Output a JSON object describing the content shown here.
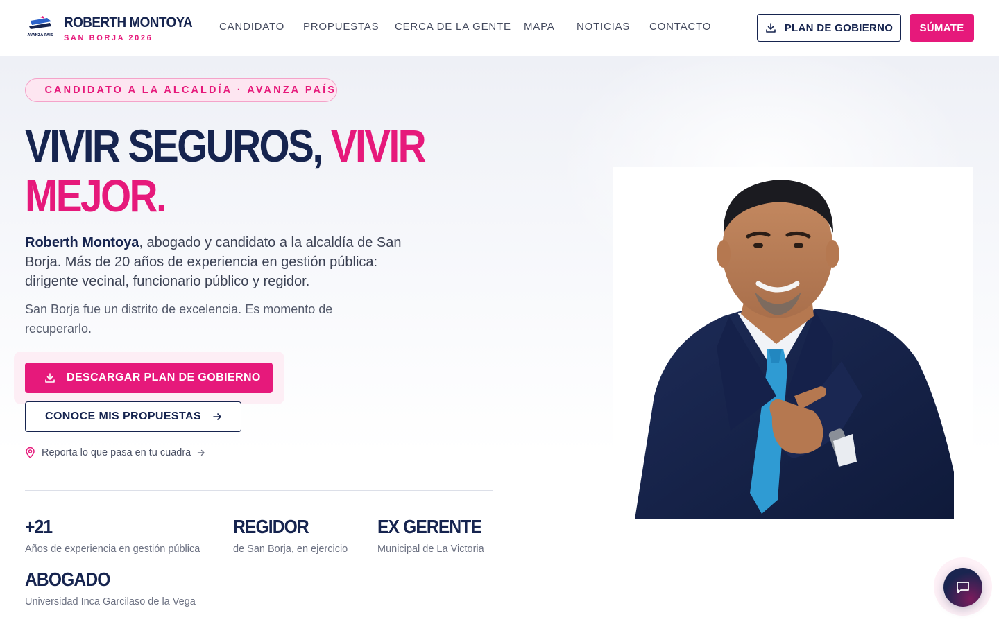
{
  "brand": {
    "name": "ROBERTH MONTOYA",
    "subtitle": "SAN BORJA 2026",
    "logo_text": "AVANZA PAÍS"
  },
  "nav": {
    "items": [
      {
        "label": "CANDIDATO"
      },
      {
        "label": "PROPUESTAS"
      },
      {
        "label": "CERCA DE LA GENTE"
      },
      {
        "label": "MAPA"
      },
      {
        "label": "NOTICIAS"
      },
      {
        "label": "CONTACTO"
      }
    ],
    "plan_button": "PLAN DE GOBIERNO",
    "join_button": "SÚMATE"
  },
  "hero": {
    "badge": "CANDIDATO A LA ALCALDÍA · AVANZA PAÍS",
    "headline_part1": "VIVIR SEGUROS, ",
    "headline_part2": "VIVIR",
    "headline_part3": "MEJOR.",
    "intro_name": "Roberth Montoya",
    "intro_rest": ", abogado y candidato a la alcaldía de San Borja. Más de 20 años de experiencia en gestión pública: dirigente vecinal, funcionario público y regidor.",
    "tagline": "San Borja fue un distrito de excelencia. Es momento de recuperarlo.",
    "download_button": "DESCARGAR PLAN DE GOBIERNO",
    "proposals_button": "CONOCE MIS PROPUESTAS",
    "report_link": "Reporta lo que pasa en tu cuadra"
  },
  "stats": [
    {
      "value": "+21",
      "label": "Años de experiencia en gestión pública"
    },
    {
      "value": "REGIDOR",
      "label": "de San Borja, en ejercicio"
    },
    {
      "value": "EX GERENTE",
      "label": "Municipal de La Victoria"
    },
    {
      "value": "ABOGADO",
      "label": "Universidad Inca Garcilaso de la Vega"
    }
  ],
  "colors": {
    "navy": "#16244f",
    "pink": "#e6197b",
    "tie": "#2f9bd3"
  },
  "icons": {
    "download": "download-icon",
    "arrow": "arrow-right-icon",
    "pin": "map-pin-icon",
    "chat": "chat-bubble-icon"
  }
}
